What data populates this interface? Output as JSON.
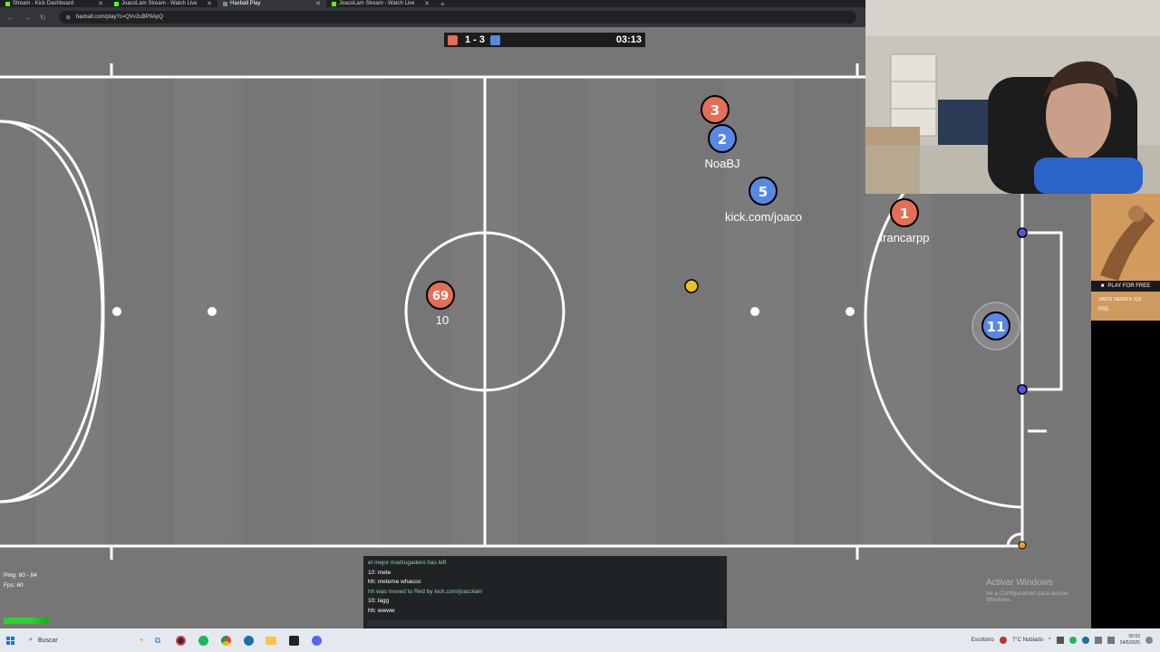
{
  "browser": {
    "tabs": [
      {
        "label": "Stream - Kick Dashboard",
        "active": false
      },
      {
        "label": "JoacoLam Stream - Watch Live",
        "active": false
      },
      {
        "label": "Haxball Play",
        "active": true
      },
      {
        "label": "JoacoLam Stream - Watch Live",
        "active": false
      }
    ],
    "new_tab": "+",
    "close_glyph": "✕",
    "url": "haxball.com/play?c=QVv2uBP9ApQ"
  },
  "game": {
    "score": "1 - 3",
    "time": "03:13",
    "colors": {
      "red": "#e56e56",
      "blue": "#5689e5",
      "ball": "#f0c020",
      "field": "#777777"
    },
    "players": [
      {
        "team": "red",
        "number": "3",
        "name": ""
      },
      {
        "team": "blue",
        "number": "2",
        "name": "NoaBJ"
      },
      {
        "team": "blue",
        "number": "5",
        "name": "kick.com/joaco"
      },
      {
        "team": "red",
        "number": "1",
        "name": "francarpp"
      },
      {
        "team": "red",
        "number": "69",
        "name": "10"
      },
      {
        "team": "blue",
        "number": "11",
        "name": ""
      }
    ],
    "chat": [
      {
        "text": "el mejor madrugadero has left",
        "notice": true
      },
      {
        "text": "10: mete",
        "notice": false
      },
      {
        "text": "hh: meteme whacoo",
        "notice": false
      },
      {
        "text": "hh was moved to Red by kick.com/joacolam",
        "notice": true
      },
      {
        "text": "10: lagg",
        "notice": false
      },
      {
        "text": "hh: wwww",
        "notice": false
      }
    ],
    "stats": {
      "ping": "Ping: 60 - 84",
      "fps": "Fps: 60"
    }
  },
  "ad": {
    "play": "PLAY FOR FREE",
    "xbox": "XBOX SERIES X|S",
    "ps5": "PS5"
  },
  "watermark": {
    "title": "Activar Windows",
    "subtitle": "Ve a Configuración para activar Windows."
  },
  "taskbar": {
    "search_placeholder": "Buscar",
    "search_icon": "search-icon",
    "keyboard": "Escritorio",
    "weather": "7°C  Nublado",
    "time": "05:03",
    "date": "24/5/2025"
  }
}
